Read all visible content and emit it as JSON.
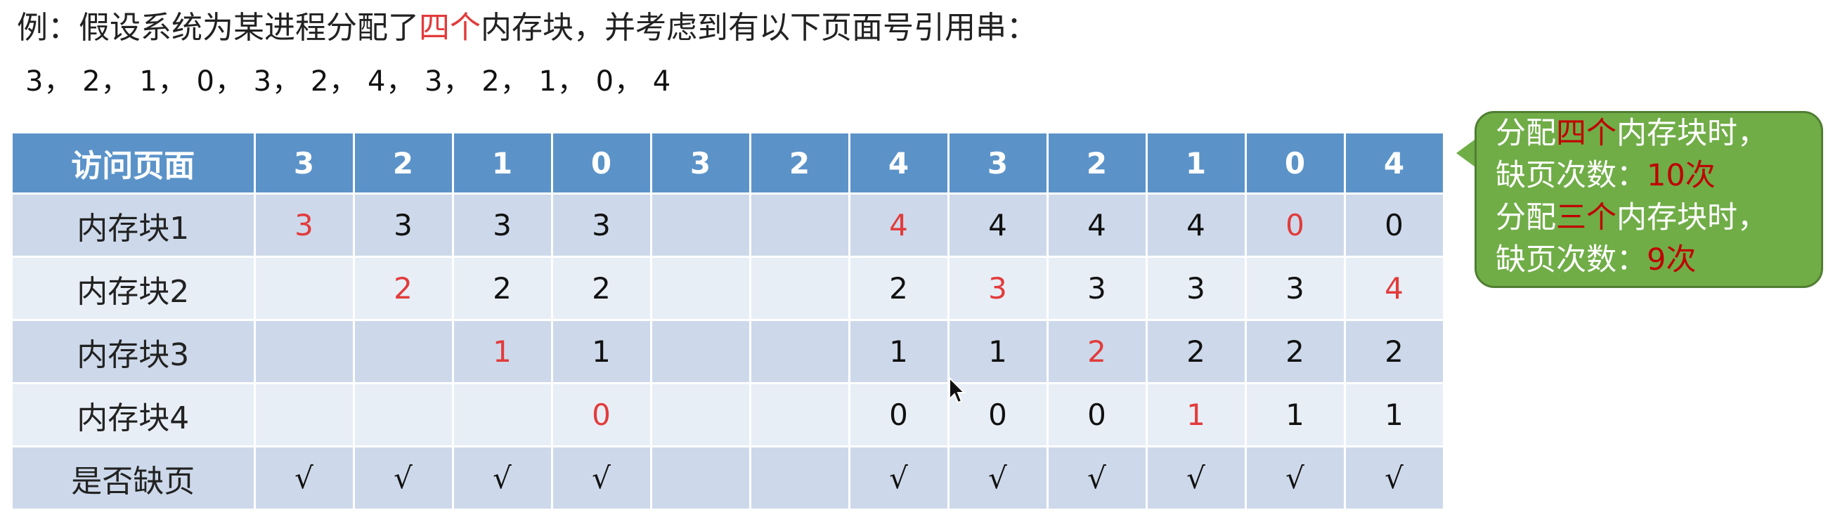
{
  "intro": {
    "before": "例：假设系统为某进程分配了",
    "highlight": "四个",
    "after": "内存块，并考虑到有以下页面号引用串："
  },
  "sequence": "3， 2， 1， 0， 3， 2， 4， 3， 2， 1， 0， 4",
  "table": {
    "header_label": "访问页面",
    "pages": [
      "3",
      "2",
      "1",
      "0",
      "3",
      "2",
      "4",
      "3",
      "2",
      "1",
      "0",
      "4"
    ],
    "rows": [
      {
        "label": "内存块1",
        "cells": [
          {
            "v": "3",
            "new": true
          },
          {
            "v": "3",
            "new": false
          },
          {
            "v": "3",
            "new": false
          },
          {
            "v": "3",
            "new": false
          },
          {
            "v": "",
            "new": false
          },
          {
            "v": "",
            "new": false
          },
          {
            "v": "4",
            "new": true
          },
          {
            "v": "4",
            "new": false
          },
          {
            "v": "4",
            "new": false
          },
          {
            "v": "4",
            "new": false
          },
          {
            "v": "0",
            "new": true
          },
          {
            "v": "0",
            "new": false
          }
        ]
      },
      {
        "label": "内存块2",
        "cells": [
          {
            "v": "",
            "new": false
          },
          {
            "v": "2",
            "new": true
          },
          {
            "v": "2",
            "new": false
          },
          {
            "v": "2",
            "new": false
          },
          {
            "v": "",
            "new": false
          },
          {
            "v": "",
            "new": false
          },
          {
            "v": "2",
            "new": false
          },
          {
            "v": "3",
            "new": true
          },
          {
            "v": "3",
            "new": false
          },
          {
            "v": "3",
            "new": false
          },
          {
            "v": "3",
            "new": false
          },
          {
            "v": "4",
            "new": true
          }
        ]
      },
      {
        "label": "内存块3",
        "cells": [
          {
            "v": "",
            "new": false
          },
          {
            "v": "",
            "new": false
          },
          {
            "v": "1",
            "new": true
          },
          {
            "v": "1",
            "new": false
          },
          {
            "v": "",
            "new": false
          },
          {
            "v": "",
            "new": false
          },
          {
            "v": "1",
            "new": false
          },
          {
            "v": "1",
            "new": false
          },
          {
            "v": "2",
            "new": true
          },
          {
            "v": "2",
            "new": false
          },
          {
            "v": "2",
            "new": false
          },
          {
            "v": "2",
            "new": false
          }
        ]
      },
      {
        "label": "内存块4",
        "cells": [
          {
            "v": "",
            "new": false
          },
          {
            "v": "",
            "new": false
          },
          {
            "v": "",
            "new": false
          },
          {
            "v": "0",
            "new": true
          },
          {
            "v": "",
            "new": false
          },
          {
            "v": "",
            "new": false
          },
          {
            "v": "0",
            "new": false
          },
          {
            "v": "0",
            "new": false
          },
          {
            "v": "0",
            "new": false
          },
          {
            "v": "1",
            "new": true
          },
          {
            "v": "1",
            "new": false
          },
          {
            "v": "1",
            "new": false
          }
        ]
      }
    ],
    "fault_row": {
      "label": "是否缺页",
      "cells": [
        "√",
        "√",
        "√",
        "√",
        "",
        "",
        "√",
        "√",
        "√",
        "√",
        "√",
        "√"
      ]
    }
  },
  "callout": {
    "line1_a": "分配",
    "line1_hl": "四个",
    "line1_b": "内存块时，",
    "line2_a": "缺页次数：",
    "line2_hl": "10次",
    "line3_a": "分配",
    "line3_hl": "三个",
    "line3_b": "内存块时，",
    "line4_a": "缺页次数：",
    "line4_hl": "9次"
  },
  "colors": {
    "header_blue": "#5b93c9",
    "row_dark": "#cdd9ea",
    "row_light": "#e8eef6",
    "new_value_red": "#e23b3b",
    "callout_green": "#70ad47",
    "callout_highlight": "#c00000"
  },
  "icons": {
    "cursor": "mouse-pointer-icon"
  }
}
